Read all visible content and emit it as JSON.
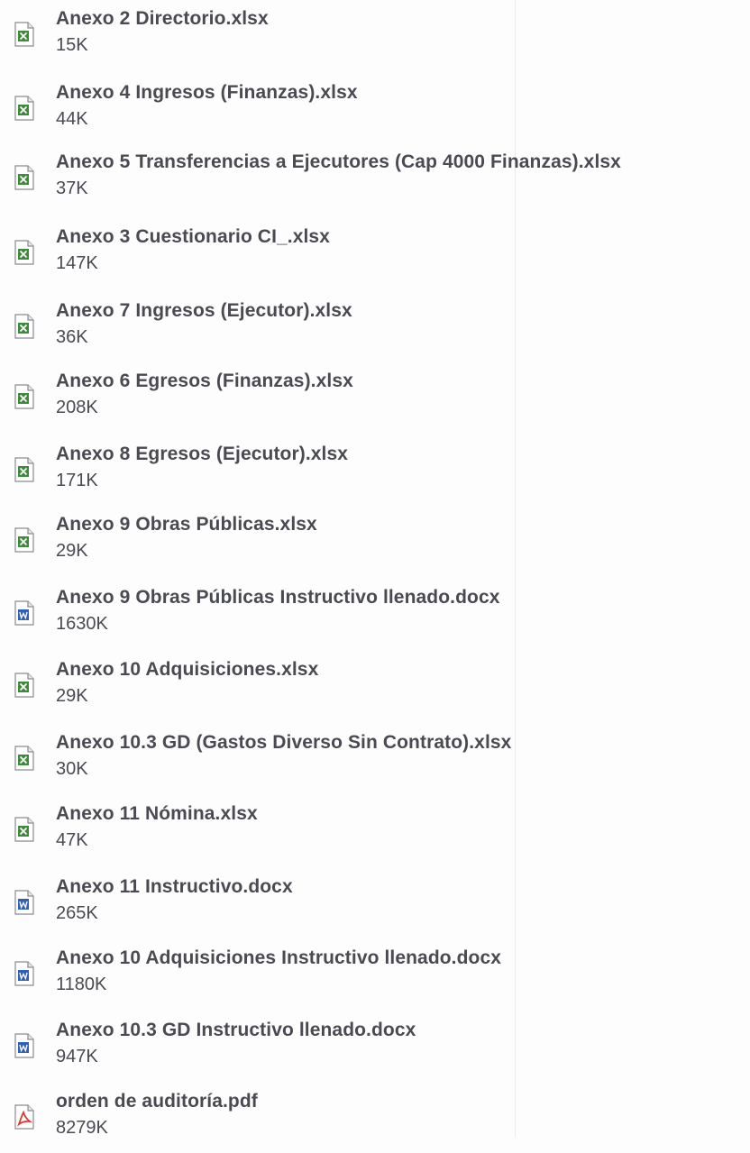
{
  "files": [
    {
      "name": "Anexo 2 Directorio.xlsx",
      "size": "15K",
      "icon": "excel-file-icon",
      "type": "xlsx"
    },
    {
      "name": "Anexo 4 Ingresos (Finanzas).xlsx",
      "size": "44K",
      "icon": "excel-file-icon",
      "type": "xlsx"
    },
    {
      "name": "Anexo 5 Transferencias a Ejecutores (Cap 4000 Finanzas).xlsx",
      "size": "37K",
      "icon": "excel-file-icon",
      "type": "xlsx"
    },
    {
      "name": "Anexo 3 Cuestionario CI_.xlsx",
      "size": "147K",
      "icon": "excel-file-icon",
      "type": "xlsx"
    },
    {
      "name": "Anexo 7 Ingresos (Ejecutor).xlsx",
      "size": "36K",
      "icon": "excel-file-icon",
      "type": "xlsx"
    },
    {
      "name": "Anexo 6 Egresos (Finanzas).xlsx",
      "size": "208K",
      "icon": "excel-file-icon",
      "type": "xlsx"
    },
    {
      "name": "Anexo 8 Egresos (Ejecutor).xlsx",
      "size": "171K",
      "icon": "excel-file-icon",
      "type": "xlsx"
    },
    {
      "name": "Anexo 9 Obras Públicas.xlsx",
      "size": "29K",
      "icon": "excel-file-icon",
      "type": "xlsx"
    },
    {
      "name": "Anexo 9 Obras Públicas Instructivo llenado.docx",
      "size": "1630K",
      "icon": "word-file-icon",
      "type": "docx"
    },
    {
      "name": "Anexo 10 Adquisiciones.xlsx",
      "size": "29K",
      "icon": "excel-file-icon",
      "type": "xlsx"
    },
    {
      "name": "Anexo 10.3 GD (Gastos Diverso Sin Contrato).xlsx",
      "size": "30K",
      "icon": "excel-file-icon",
      "type": "xlsx"
    },
    {
      "name": "Anexo 11 Nómina.xlsx",
      "size": "47K",
      "icon": "excel-file-icon",
      "type": "xlsx"
    },
    {
      "name": "Anexo 11 Instructivo.docx",
      "size": "265K",
      "icon": "word-file-icon",
      "type": "docx"
    },
    {
      "name": "Anexo 10 Adquisiciones Instructivo llenado.docx",
      "size": "1180K",
      "icon": "word-file-icon",
      "type": "docx"
    },
    {
      "name": "Anexo 10.3 GD Instructivo llenado.docx",
      "size": "947K",
      "icon": "word-file-icon",
      "type": "docx"
    },
    {
      "name": "orden de auditoría.pdf",
      "size": "8279K",
      "icon": "pdf-file-icon",
      "type": "pdf"
    }
  ],
  "colors": {
    "text": "#4a4a52",
    "excel": "#3e8a3a",
    "word": "#2f5fb8",
    "pdf": "#d83a2f"
  }
}
